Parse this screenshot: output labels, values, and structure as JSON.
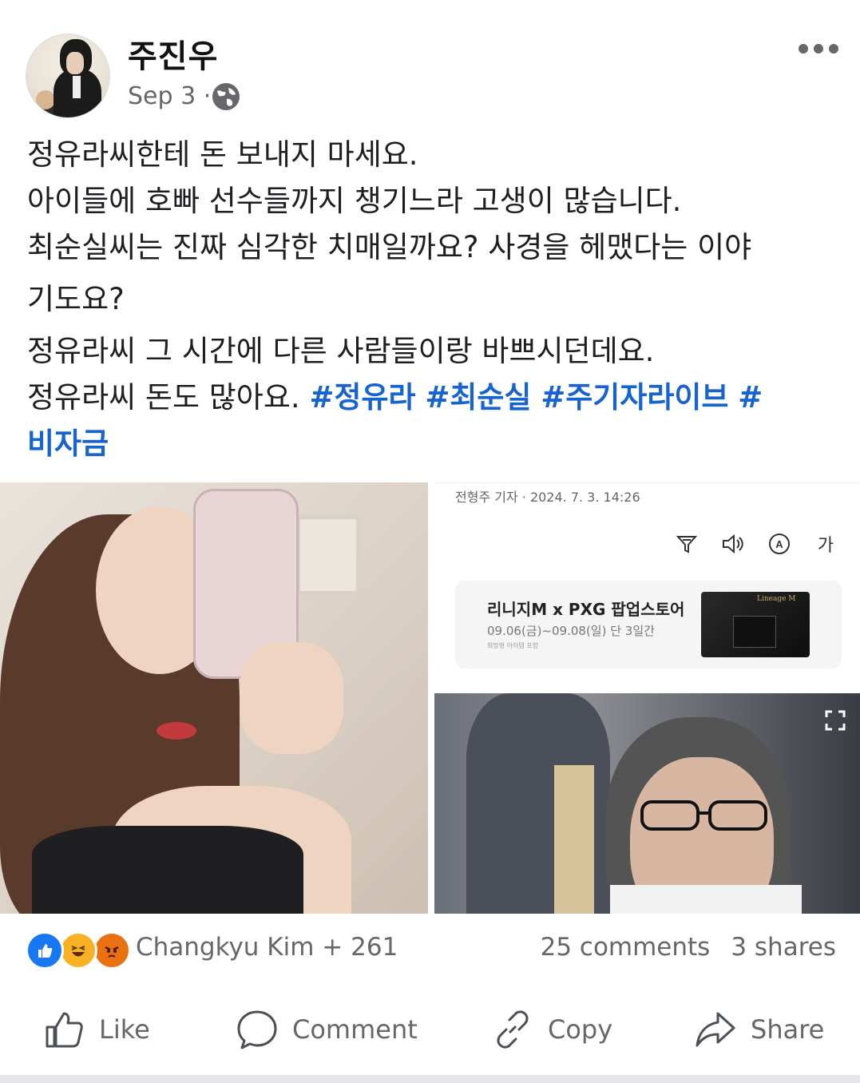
{
  "post": {
    "author": "주진우",
    "date": "Sep 3 ·",
    "privacy_icon": "globe-icon",
    "more_icon": "more-dots-icon",
    "lines": [
      "정유라씨한테 돈 보내지 마세요.",
      "아이들에 호빠 선수들까지 챙기느라 고생이 많습니다.",
      "최순실씨는 진짜 심각한 치매일까요? 사경을 헤맸다는 이야",
      "기도요?",
      "정유라씨 그 시간에 다른 사람들이랑 바쁘시던데요."
    ],
    "last_line_text": "정유라씨 돈도 많아요.",
    "hashtags": [
      "#정유라",
      "#최순실",
      "#주기자라이브",
      "#"
    ],
    "hashtag_wrap": "비자금"
  },
  "news_card": {
    "meta": "전형주 기자 · 2024. 7. 3. 14:26",
    "icons": [
      "filter-icon",
      "speaker-icon",
      "translate-icon",
      "font-size-icon"
    ],
    "font_size_label": "가",
    "ad_title": "리니지M x PXG 팝업스토어",
    "ad_date": "09.06(금)~09.08(일) 단 3일간",
    "ad_small": "희망형 아이템 포함",
    "ad_thumb_text": "Lineage M"
  },
  "stats": {
    "reactors": "Changkyu Kim + 261",
    "comments": "25 comments",
    "shares": "3 shares"
  },
  "actions": {
    "like": "Like",
    "comment": "Comment",
    "copy": "Copy",
    "share": "Share"
  },
  "colors": {
    "hashtag": "#1763cf",
    "secondary_text": "#65676b",
    "like_blue": "#1877f2"
  }
}
